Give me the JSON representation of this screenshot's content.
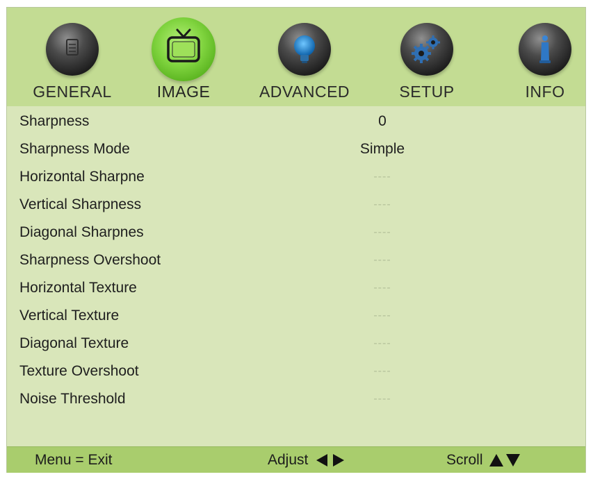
{
  "tabs": [
    {
      "label": "GENERAL",
      "icon": "document-icon",
      "active": false
    },
    {
      "label": "IMAGE",
      "icon": "tv-icon",
      "active": true
    },
    {
      "label": "ADVANCED",
      "icon": "lightbulb-icon",
      "active": false
    },
    {
      "label": "SETUP",
      "icon": "gear-icon",
      "active": false
    },
    {
      "label": "INFO",
      "icon": "info-icon",
      "active": false
    }
  ],
  "settings": [
    {
      "name": "Sharpness",
      "value": "0",
      "enabled": true
    },
    {
      "name": "Sharpness Mode",
      "value": "Simple",
      "enabled": true
    },
    {
      "name": "Horizontal Sharpne",
      "value": "----",
      "enabled": false
    },
    {
      "name": "Vertical Sharpness",
      "value": "----",
      "enabled": false
    },
    {
      "name": "Diagonal Sharpnes",
      "value": "----",
      "enabled": false
    },
    {
      "name": "Sharpness Overshoot",
      "value": "----",
      "enabled": false
    },
    {
      "name": "Horizontal Texture",
      "value": "----",
      "enabled": false
    },
    {
      "name": "Vertical Texture",
      "value": "----",
      "enabled": false
    },
    {
      "name": "Diagonal Texture",
      "value": "----",
      "enabled": false
    },
    {
      "name": "Texture Overshoot",
      "value": "----",
      "enabled": false
    },
    {
      "name": "Noise Threshold",
      "value": "----",
      "enabled": false
    }
  ],
  "footer": {
    "exit": "Menu = Exit",
    "adjust": "Adjust",
    "scroll": "Scroll"
  },
  "colors": {
    "panel_bg": "#d9e6ba",
    "header_bg": "#c3dc93",
    "footer_bg": "#a9cd6d",
    "active_icon": "#7fd33e"
  }
}
